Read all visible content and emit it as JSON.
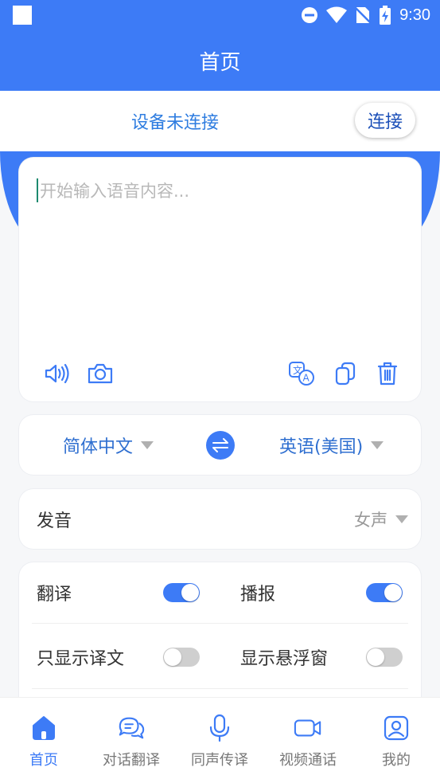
{
  "status_bar": {
    "time": "9:30"
  },
  "app_bar": {
    "title": "首页"
  },
  "connection": {
    "status_text": "设备未连接",
    "connect_label": "连接"
  },
  "input": {
    "placeholder": "开始输入语音内容..."
  },
  "input_tools": [
    {
      "icon": "speaker-icon"
    },
    {
      "icon": "camera-icon"
    },
    {
      "icon": "translate-icon"
    },
    {
      "icon": "copy-icon"
    },
    {
      "icon": "trash-icon"
    }
  ],
  "languages": {
    "source": "简体中文",
    "target": "英语(美国)"
  },
  "voice": {
    "label": "发音",
    "value": "女声"
  },
  "settings": {
    "translate": {
      "label": "翻译",
      "on": true
    },
    "broadcast": {
      "label": "播报",
      "on": true
    },
    "only_translation": {
      "label": "只显示译文",
      "on": false
    },
    "floating_window": {
      "label": "显示悬浮窗",
      "on": false
    }
  },
  "bottom_nav": [
    {
      "label": "首页",
      "icon": "home-icon",
      "active": true
    },
    {
      "label": "对话翻译",
      "icon": "chat-icon",
      "active": false
    },
    {
      "label": "同声传译",
      "icon": "microphone-icon",
      "active": false
    },
    {
      "label": "视频通话",
      "icon": "video-icon",
      "active": false
    },
    {
      "label": "我的",
      "icon": "profile-icon",
      "active": false
    }
  ],
  "colors": {
    "primary": "#3d7bf6",
    "link": "#2f7de0",
    "background": "#f6f7f9"
  }
}
